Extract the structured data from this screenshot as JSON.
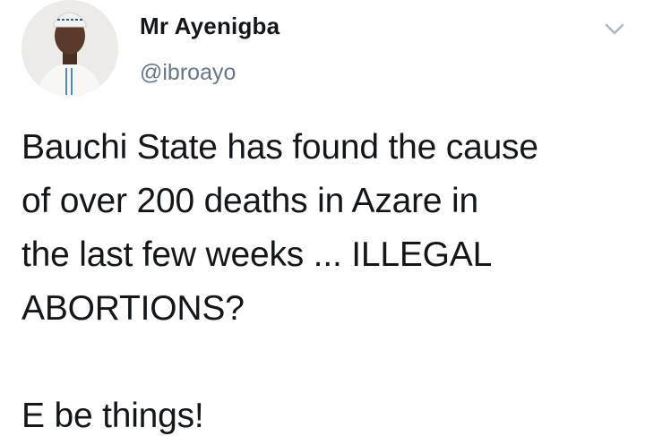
{
  "author": {
    "name": "Mr Ayenigba",
    "handle": "@ibroayo",
    "avatar_icon": "user-avatar-photo"
  },
  "menu": {
    "icon": "chevron-down-icon"
  },
  "tweet": {
    "lines": [
      "Bauchi State has found the cause",
      "of over 200 deaths in Azare in",
      "the last few weeks ... ILLEGAL",
      "ABORTIONS?",
      "E be things!"
    ]
  },
  "colors": {
    "text": "#14171a",
    "secondary": "#657786",
    "chevron": "#aab8c2"
  }
}
